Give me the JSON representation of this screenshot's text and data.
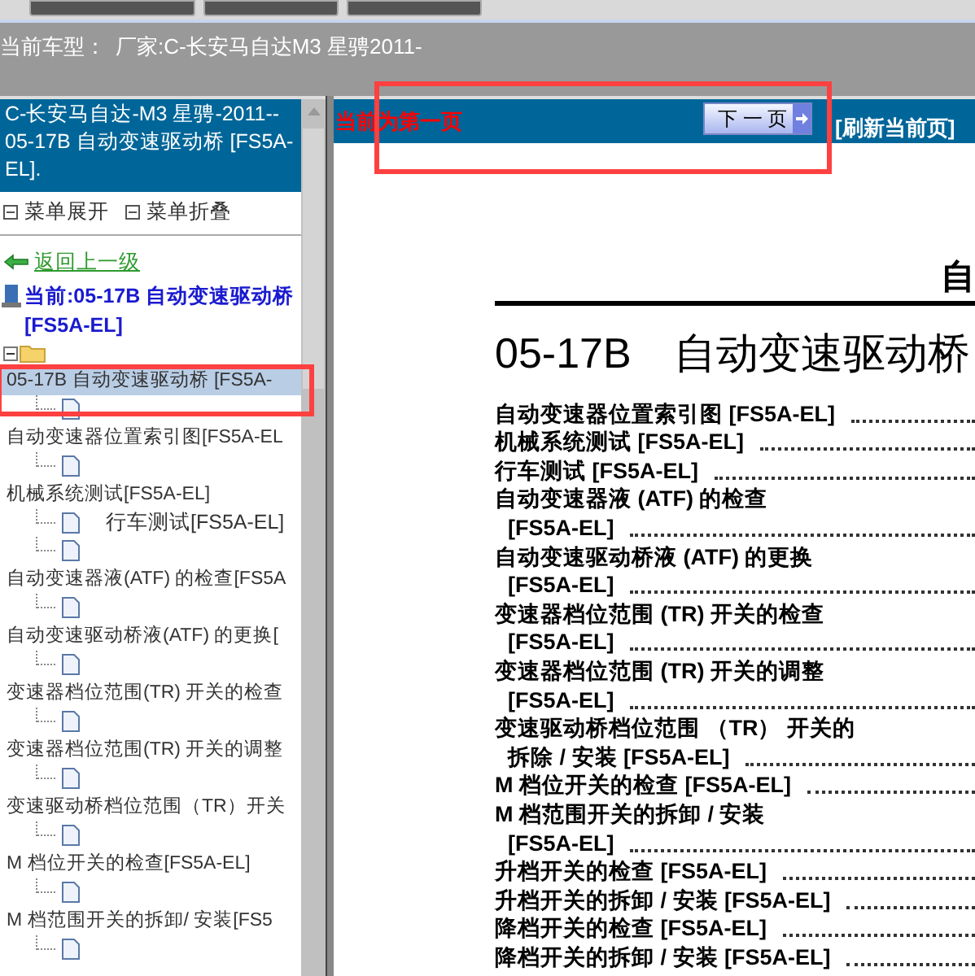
{
  "header": {
    "vehicle_label": "当前车型：",
    "vehicle": "厂家:C-长安马自达M3 星骋2011-"
  },
  "sidebar": {
    "title": "C-长安马自达-M3 星骋-2011-- 05-17B 自动变速驱动桥 [FS5A-EL].",
    "menu_expand": "菜单展开",
    "menu_collapse": "菜单折叠",
    "back_link": "返回上一级",
    "current": "当前:05-17B 自动变速驱动桥 [FS5A-EL]",
    "tree": {
      "expanded": true,
      "children": [
        {
          "label": "05-17B 自动变速驱动桥 [FS5A-",
          "selected": true
        },
        {
          "label": "自动变速器位置索引图[FS5A-EL",
          "selected": false
        },
        {
          "label": "机械系统测试[FS5A-EL]",
          "selected": false,
          "children": [
            {
              "label": "行车测试[FS5A-EL]",
              "selected": false
            }
          ]
        },
        {
          "label": "自动变速器液(ATF) 的检查[FS5A",
          "selected": false
        },
        {
          "label": "自动变速驱动桥液(ATF) 的更换[",
          "selected": false
        },
        {
          "label": "变速器档位范围(TR) 开关的检查",
          "selected": false
        },
        {
          "label": "变速器档位范围(TR) 开关的调整",
          "selected": false
        },
        {
          "label": "变速驱动桥档位范围（TR）开关",
          "selected": false
        },
        {
          "label": "M 档位开关的检查[FS5A-EL]",
          "selected": false
        },
        {
          "label": "M 档范围开关的拆卸/ 安装[FS5",
          "selected": false
        }
      ]
    }
  },
  "toolbar": {
    "page_status": "当前为第一页",
    "next_button": "下 一 页",
    "refresh_link": "[刷新当前页]"
  },
  "document": {
    "running_head": "自",
    "heading": "05-17B　自动变速驱动桥",
    "toc": [
      {
        "lines": [
          "自动变速器位置索引图 [FS5A-EL]"
        ]
      },
      {
        "lines": [
          "机械系统测试 [FS5A-EL]"
        ]
      },
      {
        "lines": [
          "行车测试 [FS5A-EL]"
        ]
      },
      {
        "lines": [
          "自动变速器液 (ATF) 的检查",
          "[FS5A-EL]"
        ]
      },
      {
        "lines": [
          "自动变速驱动桥液 (ATF) 的更换",
          "[FS5A-EL]"
        ]
      },
      {
        "lines": [
          "变速器档位范围 (TR) 开关的检查",
          "[FS5A-EL]"
        ]
      },
      {
        "lines": [
          "变速器档位范围 (TR) 开关的调整",
          "[FS5A-EL]"
        ]
      },
      {
        "lines": [
          "变速驱动桥档位范围 （TR） 开关的",
          "拆除 / 安装 [FS5A-EL]"
        ]
      },
      {
        "lines": [
          "M 档位开关的检查 [FS5A-EL]"
        ]
      },
      {
        "lines": [
          "M 档范围开关的拆卸 / 安装",
          "[FS5A-EL]"
        ]
      },
      {
        "lines": [
          "升档开关的检查 [FS5A-EL]"
        ]
      },
      {
        "lines": [
          "升档开关的拆卸 / 安装 [FS5A-EL]"
        ]
      },
      {
        "lines": [
          "降档开关的检查 [FS5A-EL]"
        ]
      },
      {
        "lines": [
          "降档开关的拆卸 / 安装 [FS5A-EL]"
        ]
      }
    ]
  }
}
